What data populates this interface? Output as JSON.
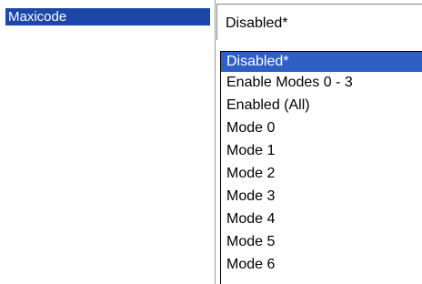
{
  "property": {
    "label": "Maxicode",
    "value": "Disabled*"
  },
  "dropdown": {
    "options": [
      "Disabled*",
      "Enable Modes 0 - 3",
      "Enabled (All)",
      "Mode 0",
      "Mode 1",
      "Mode 2",
      "Mode 3",
      "Mode 4",
      "Mode 5",
      "Mode 6"
    ],
    "selected_index": 0
  },
  "colors": {
    "selection": "#2e5fc4",
    "label_highlight": "#1c47a8"
  }
}
